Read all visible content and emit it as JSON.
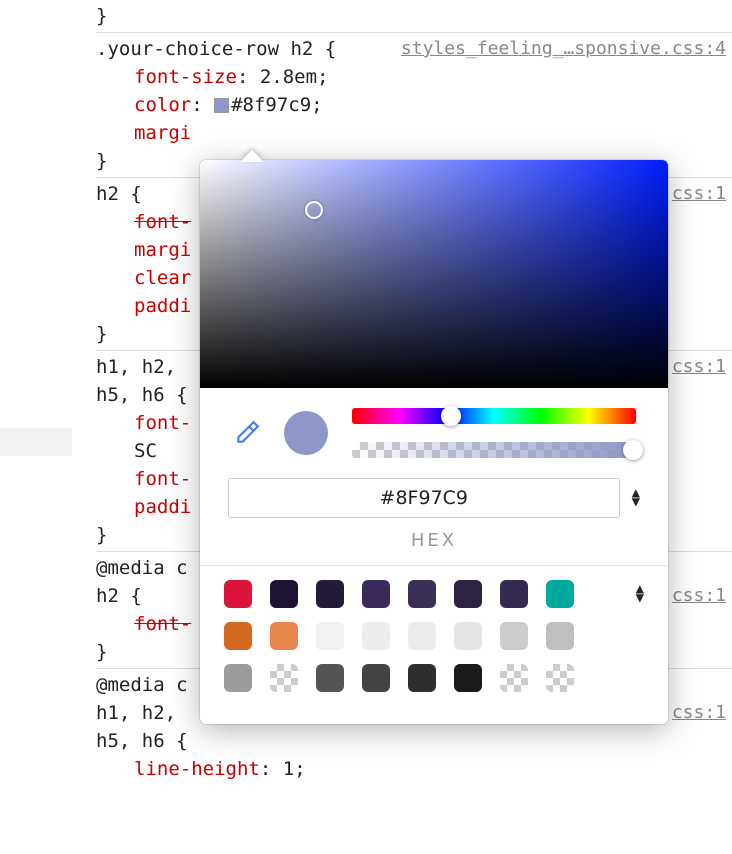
{
  "rules": [
    {
      "closingBrace": "}"
    },
    {
      "source": "styles_feeling_…sponsive.css:4",
      "selector": ".your-choice-row h2 {",
      "decls": [
        {
          "prop": "font-size",
          "val": "2.8em"
        },
        {
          "prop": "color",
          "val": "#8f97c9",
          "swatch": "#8f97c9"
        },
        {
          "prop": "margi",
          "val": "",
          "truncated": true
        }
      ],
      "close": "}"
    },
    {
      "source": "css:1",
      "selector": "h2 {",
      "decls": [
        {
          "prop": "font-",
          "strike": true
        },
        {
          "prop": "margi"
        },
        {
          "prop": "clear"
        },
        {
          "prop": "paddi"
        }
      ],
      "close": "}"
    },
    {
      "source": "css:1",
      "selector_inherited": "h1,",
      "selector_rest": " h2,",
      "line2_inherited": "h5, h6",
      "line2_rest": " {",
      "decls": [
        {
          "prop": "font-"
        },
        {
          "prop": "   SC",
          "plain": true
        },
        {
          "prop": "font-"
        },
        {
          "prop": "paddi"
        }
      ],
      "close": "}"
    },
    {
      "media": "@media c",
      "media_suffix": ")",
      "source": "css:1",
      "selector": "h2 {",
      "decls": [
        {
          "prop": "font-",
          "strike": true
        }
      ],
      "close": "}"
    },
    {
      "media": "@media c",
      "media_suffix": ")",
      "source": "css:1",
      "selector_inherited": "h1,",
      "selector_rest": " h2,",
      "line2_inherited": "h5, h6",
      "line2_rest": " {",
      "decls": [
        {
          "prop": "line-height",
          "val": "1"
        }
      ]
    }
  ],
  "picker": {
    "hex_value": "#8F97C9",
    "mode_label": "HEX",
    "current_color": "#8f97c9",
    "palette": [
      [
        "#dc143c",
        "#1f1333",
        "#241b38",
        "#3a2a5c",
        "#3b2e57",
        "#2e2245",
        "#352a50",
        "#00a99d"
      ],
      [
        "#d2691e",
        "#e8864b",
        "#f2f2f2",
        "#ececec",
        "#ececec",
        "#e4e4e4",
        "#cccccc",
        "#bfbfbf"
      ],
      [
        "#9c9c9c",
        "checker",
        "#555555",
        "#444444",
        "#2f2f2f",
        "#1a1a1a",
        "checker",
        "checker"
      ]
    ]
  }
}
